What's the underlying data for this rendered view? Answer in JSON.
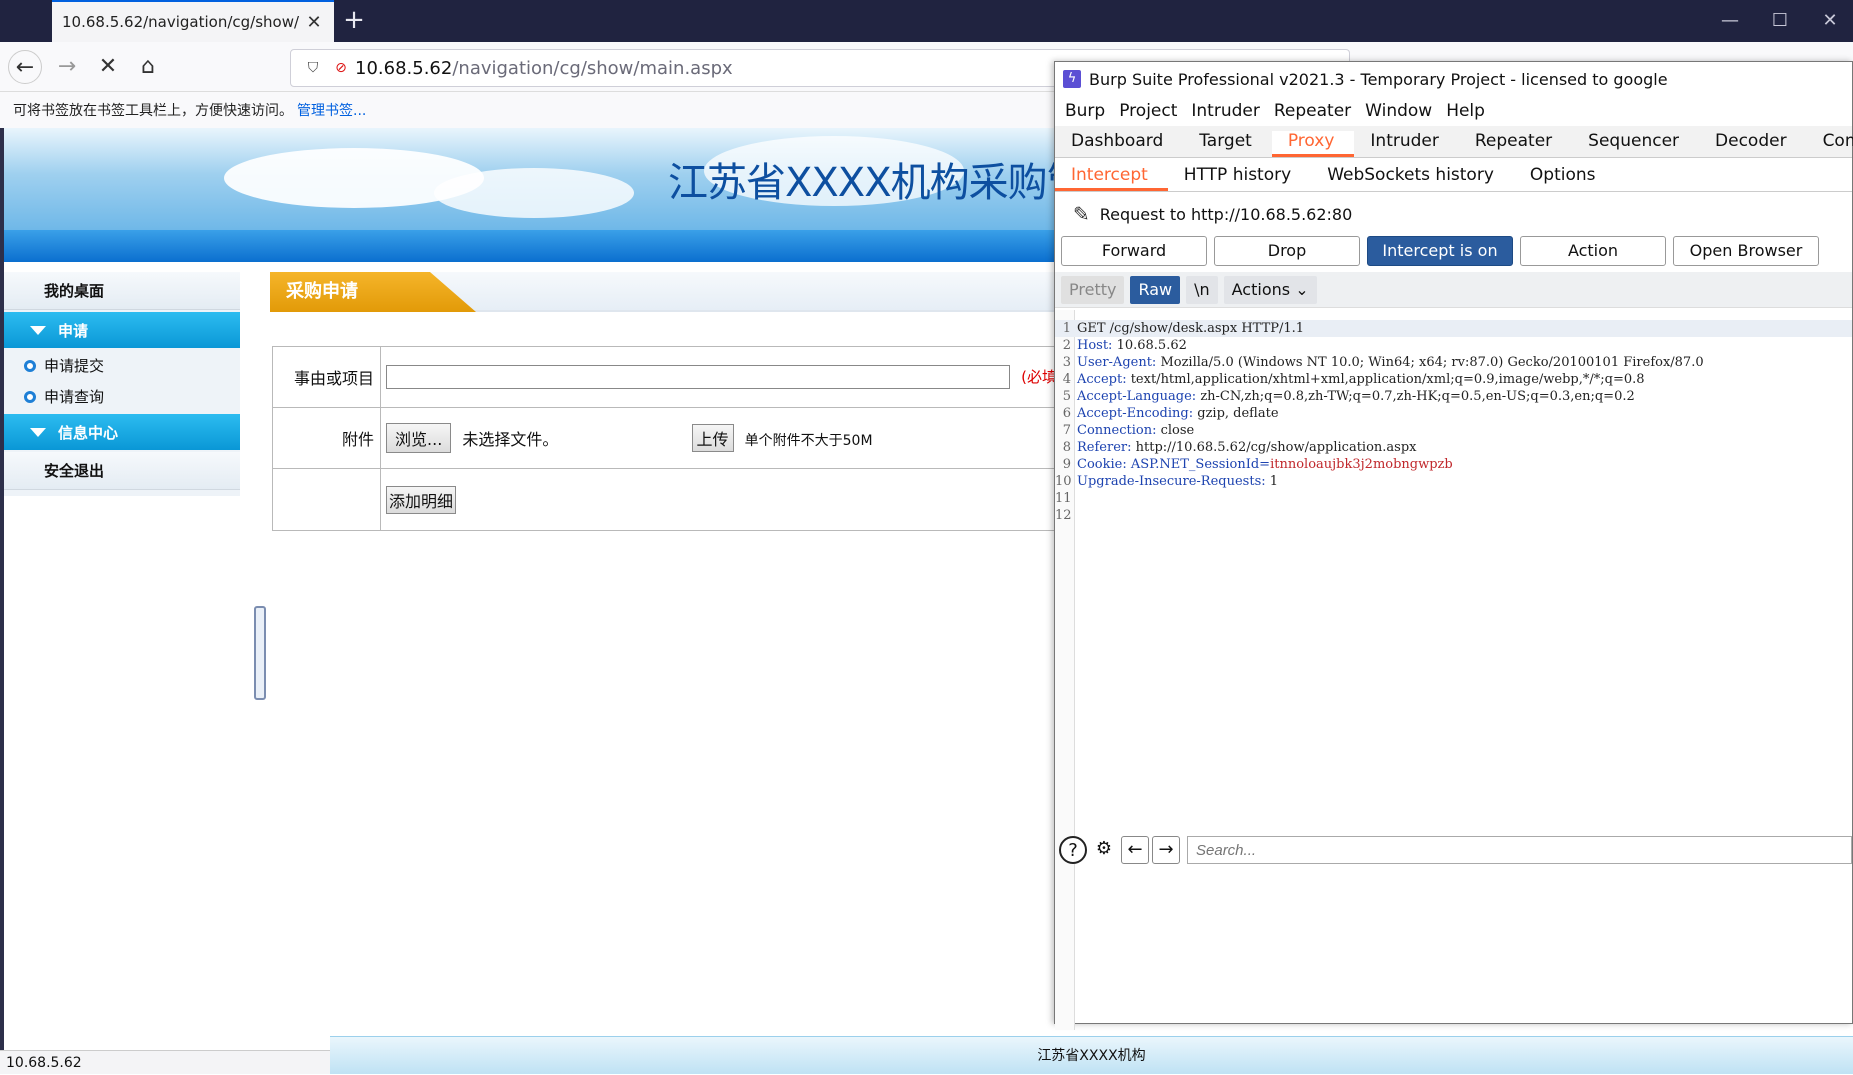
{
  "browser": {
    "tab_title": "10.68.5.62/navigation/cg/show/",
    "url_host": "10.68.5.62",
    "url_path": "/navigation/cg/show/main.aspx",
    "bookmark_hint": "可将书签放在书签工具栏上，方便快速访问。",
    "bookmark_manage": "管理书签...",
    "status_url": "10.68.5.62"
  },
  "page": {
    "site_title": "江苏省XXXX机构采购管",
    "section_title": "采购申请",
    "footer": "江苏省XXXX机构",
    "sidebar": {
      "desk": "我的桌面",
      "apply_head": "申请",
      "apply_submit": "申请提交",
      "apply_query": "申请查询",
      "info_head": "信息中心",
      "logout": "安全退出"
    },
    "form": {
      "reason_label": "事由或项目",
      "reason_value": "",
      "required_note": "(必填",
      "attach_label": "附件",
      "browse_button": "浏览...",
      "no_file": "未选择文件。",
      "upload_button": "上传",
      "attach_note": "单个附件不大于50M",
      "add_detail_button": "添加明细"
    }
  },
  "burp": {
    "window_title": "Burp Suite Professional v2021.3 - Temporary Project - licensed to google",
    "menu": [
      "Burp",
      "Project",
      "Intruder",
      "Repeater",
      "Window",
      "Help"
    ],
    "main_tabs": [
      "Dashboard",
      "Target",
      "Proxy",
      "Intruder",
      "Repeater",
      "Sequencer",
      "Decoder",
      "Compa"
    ],
    "active_main_tab": "Proxy",
    "sub_tabs": [
      "Intercept",
      "HTTP history",
      "WebSockets history",
      "Options"
    ],
    "active_sub_tab": "Intercept",
    "request_to": "Request to http://10.68.5.62:80",
    "buttons": {
      "forward": "Forward",
      "drop": "Drop",
      "intercept": "Intercept is on",
      "action": "Action",
      "open_browser": "Open Browser"
    },
    "view": {
      "pretty": "Pretty",
      "raw": "Raw",
      "newline": "\\n",
      "actions": "Actions"
    },
    "request_lines": [
      {
        "n": "1",
        "key": "",
        "val": "GET /cg/show/desk.aspx HTTP/1.1"
      },
      {
        "n": "2",
        "key": "Host:",
        "val": " 10.68.5.62"
      },
      {
        "n": "3",
        "key": "User-Agent:",
        "val": " Mozilla/5.0 (Windows NT 10.0; Win64; x64; rv:87.0) Gecko/20100101 Firefox/87.0"
      },
      {
        "n": "4",
        "key": "Accept:",
        "val": " text/html,application/xhtml+xml,application/xml;q=0.9,image/webp,*/*;q=0.8"
      },
      {
        "n": "5",
        "key": "Accept-Language:",
        "val": " zh-CN,zh;q=0.8,zh-TW;q=0.7,zh-HK;q=0.5,en-US;q=0.3,en;q=0.2"
      },
      {
        "n": "6",
        "key": "Accept-Encoding:",
        "val": " gzip, deflate"
      },
      {
        "n": "7",
        "key": "Connection:",
        "val": " close"
      },
      {
        "n": "8",
        "key": "Referer:",
        "val": " http://10.68.5.62/cg/show/application.aspx"
      },
      {
        "n": "9",
        "key": "Cookie:",
        "val": " ASP.NET_SessionId=",
        "cookie": "itnnoloaujbk3j2mobngwpzb"
      },
      {
        "n": "10",
        "key": "Upgrade-Insecure-Requests:",
        "val": " 1"
      },
      {
        "n": "11",
        "key": "",
        "val": ""
      },
      {
        "n": "12",
        "key": "",
        "val": ""
      }
    ],
    "search_placeholder": "Search..."
  },
  "colors": {
    "burp_accent": "#ff6633",
    "burp_button_blue": "#2b5c9e",
    "sidebar_head": "#0a97d6",
    "section_tab": "#e29a08",
    "site_title": "#0d4fa0"
  }
}
